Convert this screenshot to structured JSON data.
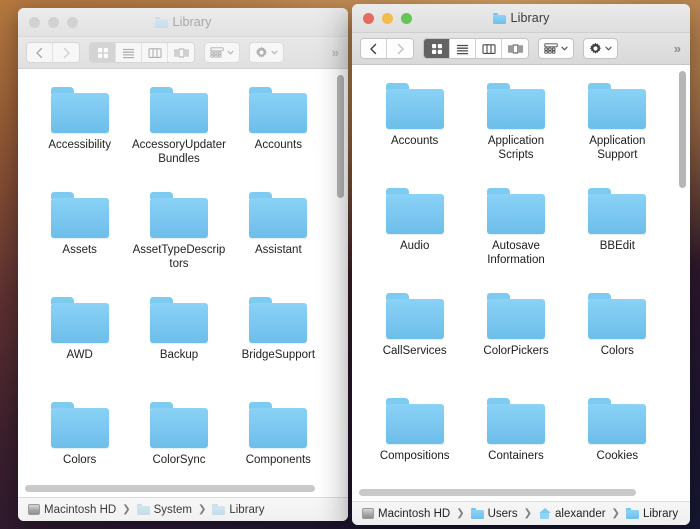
{
  "desktop": {
    "background_top": "#c08a53",
    "background_bottom": "#161a34"
  },
  "windows": {
    "left": {
      "state": "inactive",
      "title": "Library",
      "title_icon": "folder-icon",
      "traffic_lights": [
        "close",
        "minimize",
        "zoom"
      ],
      "toolbar": {
        "back_label": "‹",
        "forward_label": "›",
        "view_modes": [
          "icon-view",
          "list-view",
          "column-view",
          "gallery-view"
        ],
        "selected_view": "icon-view",
        "arrange_label": "arrange-icon",
        "action_label": "gear-icon",
        "overflow_label": "»"
      },
      "items": [
        {
          "name": "Accessibility",
          "icon": "folder-icon"
        },
        {
          "name": "AccessoryUpdaterBundles",
          "icon": "folder-icon"
        },
        {
          "name": "Accounts",
          "icon": "folder-icon"
        },
        {
          "name": "Assets",
          "icon": "folder-icon"
        },
        {
          "name": "AssetTypeDescriptors",
          "icon": "folder-icon"
        },
        {
          "name": "Assistant",
          "icon": "folder-icon"
        },
        {
          "name": "AWD",
          "icon": "folder-icon"
        },
        {
          "name": "Backup",
          "icon": "folder-icon"
        },
        {
          "name": "BridgeSupport",
          "icon": "folder-icon"
        },
        {
          "name": "Colors",
          "icon": "folder-icon"
        },
        {
          "name": "ColorSync",
          "icon": "folder-icon"
        },
        {
          "name": "Components",
          "icon": "folder-icon"
        }
      ],
      "scrollbar": {
        "vertical_thumb_pct": 30,
        "vertical_top_pct": 1,
        "horizontal_thumb_pct": 88
      },
      "pathbar": [
        {
          "label": "Macintosh HD",
          "icon": "disk-icon"
        },
        {
          "label": "System",
          "icon": "folder-icon"
        },
        {
          "label": "Library",
          "icon": "folder-icon"
        }
      ]
    },
    "right": {
      "state": "active",
      "title": "Library",
      "title_icon": "folder-icon",
      "traffic_lights": [
        "close",
        "minimize",
        "zoom"
      ],
      "toolbar": {
        "back_label": "‹",
        "forward_label": "›",
        "view_modes": [
          "icon-view",
          "list-view",
          "column-view",
          "gallery-view"
        ],
        "selected_view": "icon-view",
        "arrange_label": "arrange-icon",
        "action_label": "gear-icon",
        "overflow_label": "»"
      },
      "items": [
        {
          "name": "Accounts",
          "icon": "folder-icon"
        },
        {
          "name": "Application Scripts",
          "icon": "folder-icon"
        },
        {
          "name": "Application Support",
          "icon": "folder-icon"
        },
        {
          "name": "Audio",
          "icon": "folder-icon"
        },
        {
          "name": "Autosave Information",
          "icon": "folder-icon"
        },
        {
          "name": "BBEdit",
          "icon": "folder-icon"
        },
        {
          "name": "CallServices",
          "icon": "folder-icon"
        },
        {
          "name": "ColorPickers",
          "icon": "folder-icon"
        },
        {
          "name": "Colors",
          "icon": "folder-icon"
        },
        {
          "name": "Compositions",
          "icon": "folder-icon"
        },
        {
          "name": "Containers",
          "icon": "folder-icon"
        },
        {
          "name": "Cookies",
          "icon": "folder-icon"
        }
      ],
      "scrollbar": {
        "vertical_thumb_pct": 28,
        "vertical_top_pct": 1,
        "horizontal_thumb_pct": 82
      },
      "pathbar": [
        {
          "label": "Macintosh HD",
          "icon": "disk-icon"
        },
        {
          "label": "Users",
          "icon": "folder-icon"
        },
        {
          "label": "alexander",
          "icon": "home-icon"
        },
        {
          "label": "Library",
          "icon": "folder-icon"
        }
      ]
    }
  }
}
